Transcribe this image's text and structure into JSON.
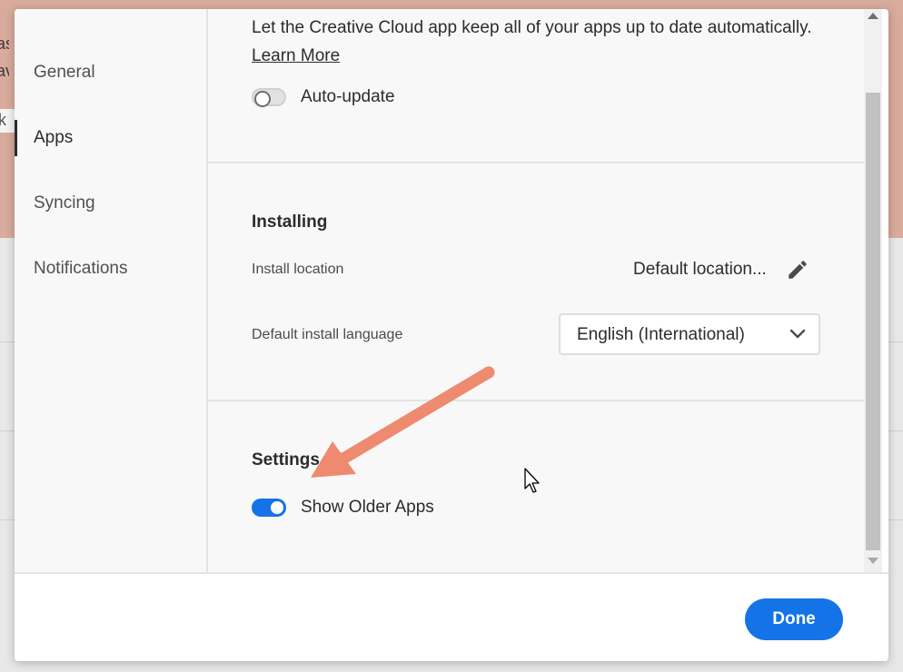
{
  "background": {
    "fragments": [
      "ass",
      "ave",
      "k"
    ]
  },
  "sidebar": {
    "items": [
      {
        "label": "General",
        "active": false
      },
      {
        "label": "Apps",
        "active": true
      },
      {
        "label": "Syncing",
        "active": false
      },
      {
        "label": "Notifications",
        "active": false
      }
    ]
  },
  "auto_update": {
    "description": "Let the Creative Cloud app keep all of your apps up to date automatically.",
    "learn_more": "Learn More",
    "toggle_label": "Auto-update",
    "enabled": false
  },
  "installing": {
    "heading": "Installing",
    "location_label": "Install location",
    "location_value": "Default location...",
    "language_label": "Default install language",
    "language_value": "English (International)"
  },
  "settings": {
    "heading": "Settings",
    "toggle_label": "Show Older Apps",
    "enabled": true
  },
  "footer": {
    "done_label": "Done"
  },
  "colors": {
    "accent": "#1473e6",
    "annotation_arrow": "#ee8a6f",
    "background_app_header": "#d9ab9c"
  }
}
